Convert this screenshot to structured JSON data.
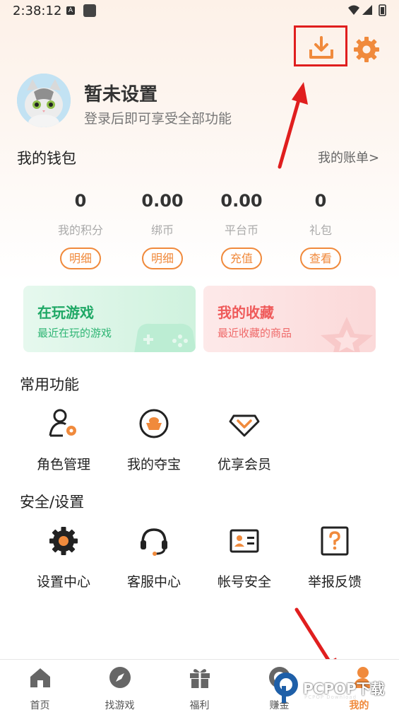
{
  "status_bar": {
    "time": "2:38:12",
    "a_badge": "A"
  },
  "profile": {
    "name": "暂未设置",
    "subtitle": "登录后即可享受全部功能"
  },
  "wallet": {
    "title": "我的钱包",
    "bill_link": "我的账单>",
    "items": [
      {
        "value": "0",
        "label": "我的积分",
        "button": "明细"
      },
      {
        "value": "0.00",
        "label": "绑币",
        "button": "明细"
      },
      {
        "value": "0.00",
        "label": "平台币",
        "button": "充值"
      },
      {
        "value": "0",
        "label": "礼包",
        "button": "查看"
      }
    ]
  },
  "cards": [
    {
      "title": "在玩游戏",
      "subtitle": "最近在玩的游戏",
      "color": "#1ea865",
      "icon": "gamepad-icon"
    },
    {
      "title": "我的收藏",
      "subtitle": "最近收藏的商品",
      "color": "#ef5a5a",
      "icon": "star-icon"
    }
  ],
  "common": {
    "title": "常用功能",
    "items": [
      {
        "label": "角色管理",
        "icon": "role-manage-icon"
      },
      {
        "label": "我的夺宝",
        "icon": "treasure-icon"
      },
      {
        "label": "优享会员",
        "icon": "diamond-icon"
      }
    ]
  },
  "security": {
    "title": "安全/设置",
    "items": [
      {
        "label": "设置中心",
        "icon": "gear-icon"
      },
      {
        "label": "客服中心",
        "icon": "headset-icon"
      },
      {
        "label": "帐号安全",
        "icon": "id-card-icon"
      },
      {
        "label": "举报反馈",
        "icon": "question-icon"
      }
    ]
  },
  "bottom_nav": {
    "items": [
      {
        "label": "首页",
        "icon": "home-icon"
      },
      {
        "label": "找游戏",
        "icon": "compass-icon"
      },
      {
        "label": "福利",
        "icon": "gift-icon"
      },
      {
        "label": "赚金",
        "icon": "coin-icon"
      },
      {
        "label": "我的",
        "icon": "profile-icon",
        "active": true
      }
    ]
  },
  "watermark": {
    "text": "PCPOP下载",
    "sub": "PCPOP Download"
  },
  "colors": {
    "accent": "#f08a3c",
    "highlight_box": "#e01e1e",
    "arrow": "#e01e1e"
  }
}
